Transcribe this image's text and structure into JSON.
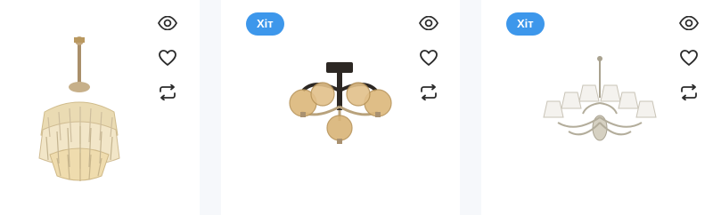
{
  "products": [
    {
      "badge": "",
      "icons": [
        "eye-icon",
        "heart-icon",
        "compare-icon"
      ]
    },
    {
      "badge": "Хіт",
      "icons": [
        "eye-icon",
        "heart-icon",
        "compare-icon"
      ]
    },
    {
      "badge": "Хіт",
      "icons": [
        "eye-icon",
        "heart-icon",
        "compare-icon"
      ]
    }
  ],
  "colors": {
    "badge_bg": "#3d97eb",
    "badge_text": "#ffffff",
    "icon": "#2b2b2b",
    "page_bg": "#f6f8fb",
    "card_bg": "#ffffff"
  }
}
